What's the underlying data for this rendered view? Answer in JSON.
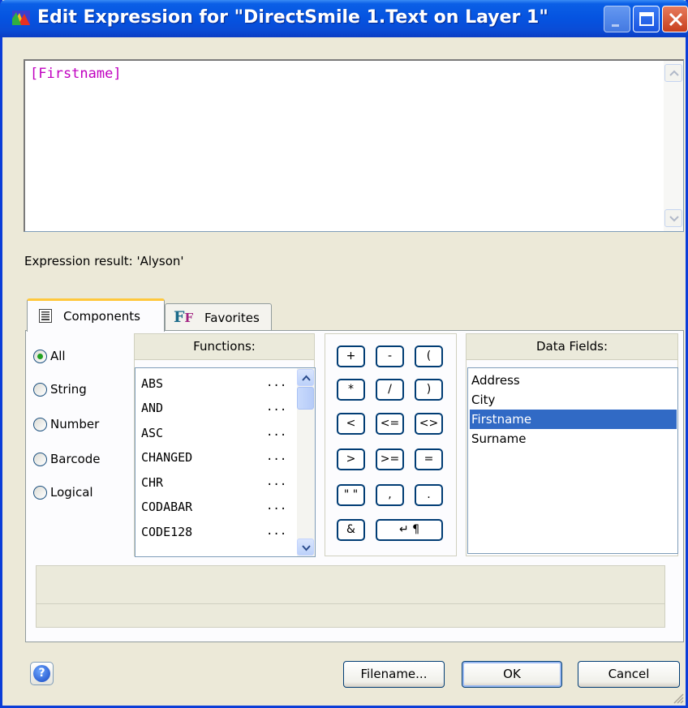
{
  "window": {
    "title": "Edit Expression for \"DirectSmile 1.Text on Layer 1\"",
    "app_icon": "directsmile-app-icon"
  },
  "editor": {
    "text": "[Firstname]",
    "text_color": "#c000c0"
  },
  "result": {
    "text": "Expression result: 'Alyson'"
  },
  "tabs": [
    {
      "label": "Components",
      "icon": "list-icon",
      "active": true
    },
    {
      "label": "Favorites",
      "icon": "ff-favorites-icon",
      "active": false
    }
  ],
  "categories": [
    {
      "label": "All",
      "checked": true
    },
    {
      "label": "String",
      "checked": false
    },
    {
      "label": "Number",
      "checked": false
    },
    {
      "label": "Barcode",
      "checked": false
    },
    {
      "label": "Logical",
      "checked": false
    }
  ],
  "functions": {
    "header": "Functions:",
    "ellipsis": "...",
    "items": [
      "ABS",
      "AND",
      "ASC",
      "CHANGED",
      "CHR",
      "CODABAR",
      "CODE128"
    ]
  },
  "operators": [
    "+",
    "-",
    "(",
    "*",
    "/",
    ")",
    "<",
    "<=",
    "<>",
    ">",
    ">=",
    "=",
    "\" \"",
    ",",
    ".",
    "&",
    "↵ ¶"
  ],
  "data_fields": {
    "header": "Data Fields:",
    "items": [
      "Address",
      "City",
      "Firstname",
      "Surname"
    ],
    "selected": "Firstname",
    "selection_color": "#316ac5"
  },
  "buttons": {
    "help": "?",
    "filename": "Filename...",
    "ok": "OK",
    "cancel": "Cancel"
  },
  "colors": {
    "titlebar": "#0553e0",
    "dialog_bg": "#ece9d8",
    "active_tab_accent": "#ffc83c",
    "radio_dot": "#21a121"
  }
}
